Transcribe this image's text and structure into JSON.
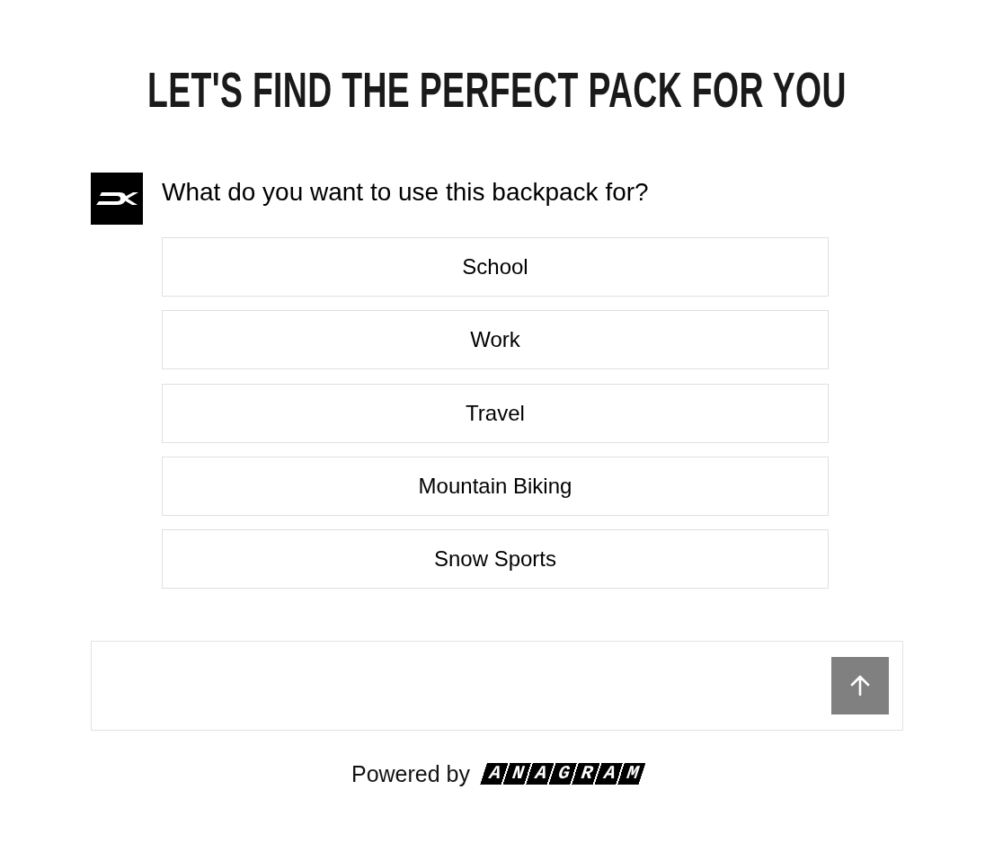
{
  "heading": "LET'S FIND THE PERFECT PACK FOR YOU",
  "question": {
    "text": "What do you want to use this backpack for?"
  },
  "options": [
    {
      "label": "School"
    },
    {
      "label": "Work"
    },
    {
      "label": "Travel"
    },
    {
      "label": "Mountain Biking"
    },
    {
      "label": "Snow Sports"
    }
  ],
  "footer": {
    "powered_by": "Powered by",
    "brand": "ANAGRAM"
  }
}
